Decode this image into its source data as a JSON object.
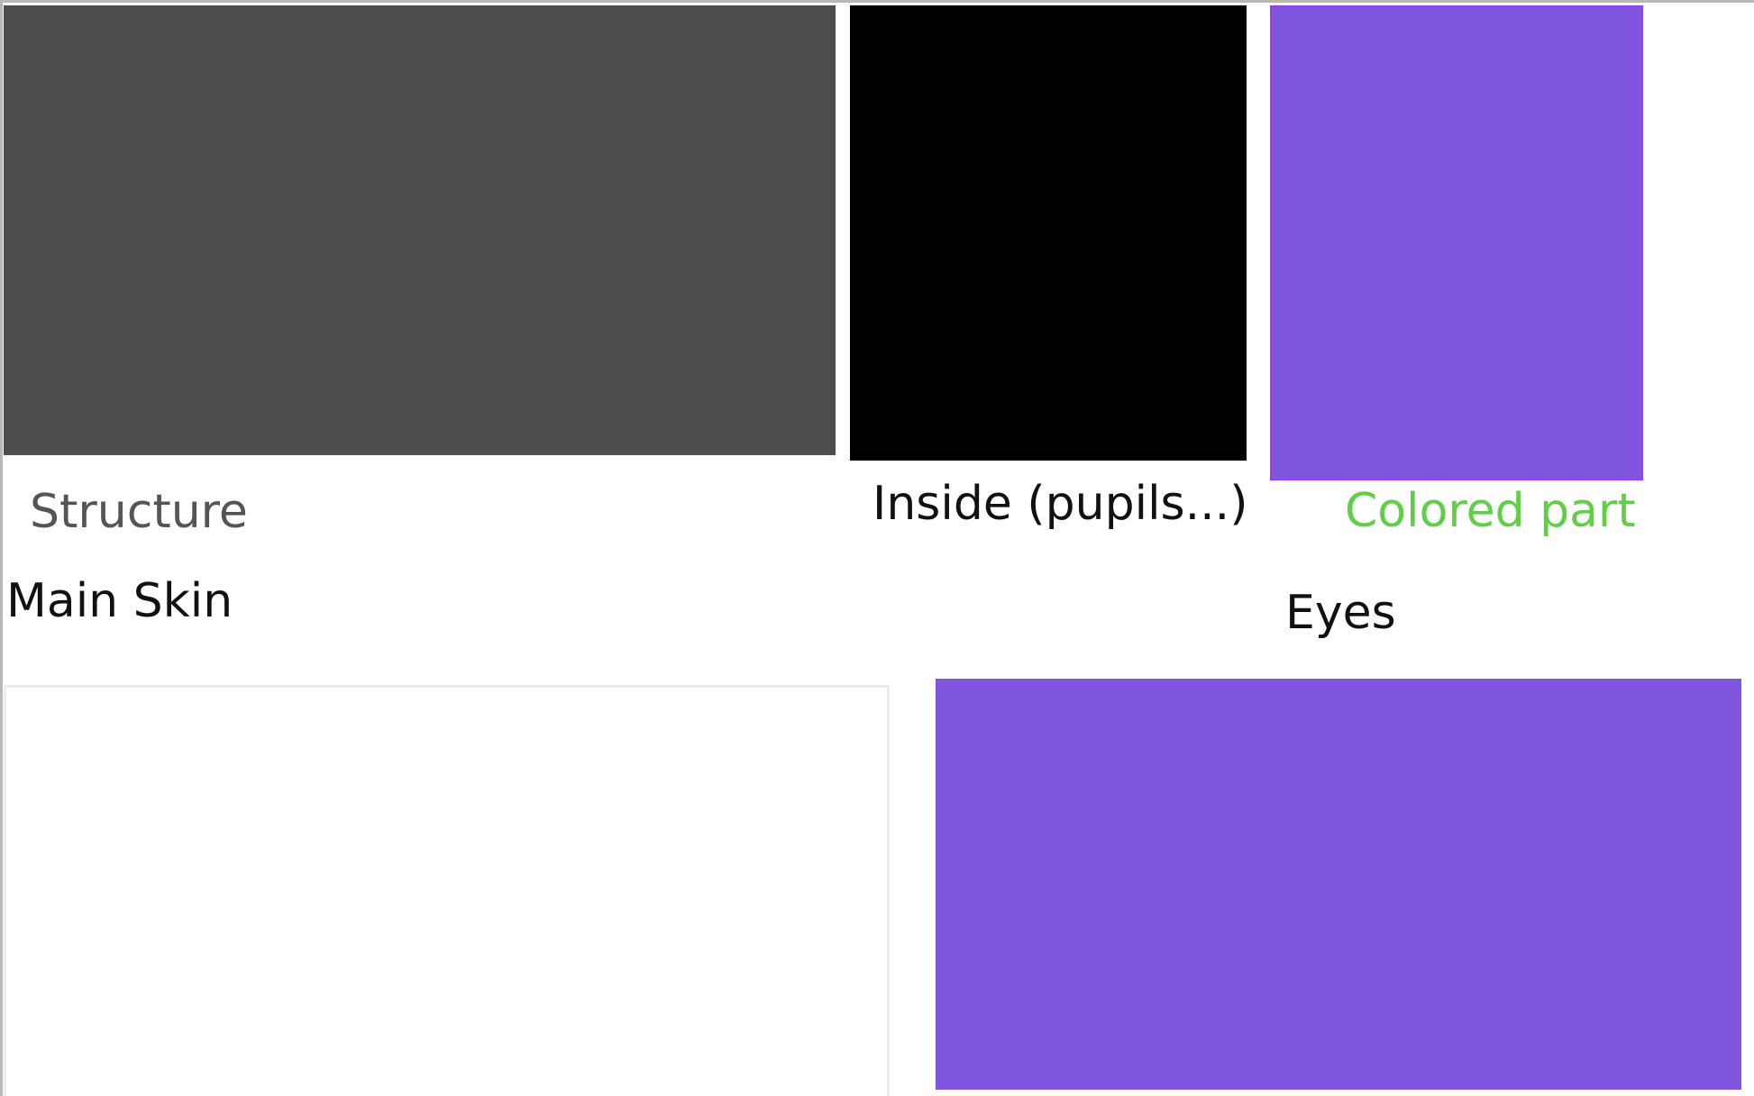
{
  "main_skin": {
    "title": "Main Skin",
    "structure": {
      "label": "Structure",
      "swatch_color": "#4e4d4e",
      "label_color": "#555555"
    },
    "secondary": {
      "swatch_color": "#ffffff",
      "border_color": "#ededed"
    }
  },
  "eyes": {
    "title": "Eyes",
    "inside": {
      "label": "Inside (pupils...)",
      "swatch_color": "#000000",
      "label_color": "#111111"
    },
    "colored_part": {
      "label": "Colored part",
      "swatch_color": "#8056df",
      "border_color": "#9b3ef0",
      "label_color": "#5fcf45"
    },
    "secondary": {
      "swatch_color": "#8056df"
    }
  }
}
